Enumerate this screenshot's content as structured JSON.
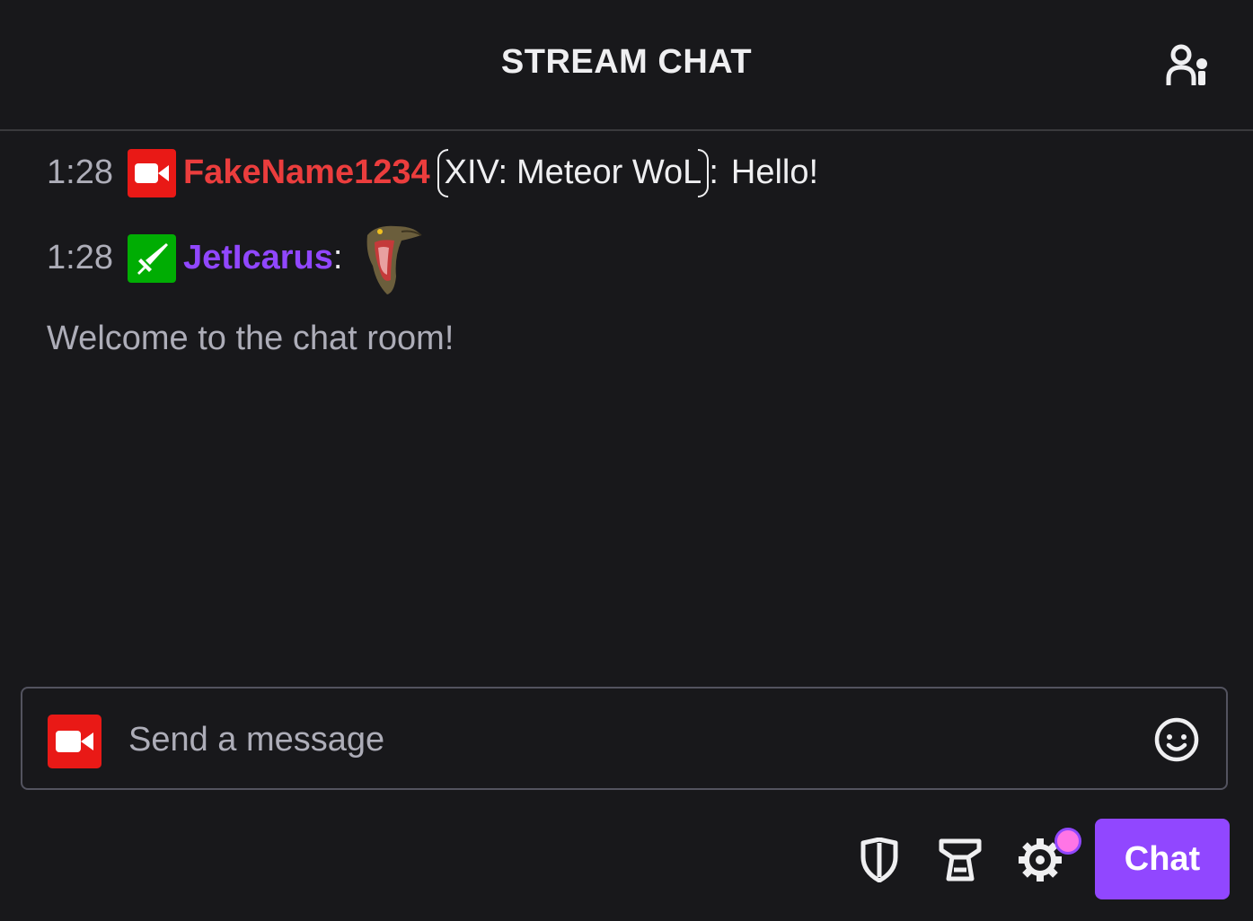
{
  "header": {
    "title": "STREAM CHAT",
    "users_icon": "users-icon"
  },
  "messages": [
    {
      "time": "1:28",
      "badge_icon": "video-camera-icon",
      "badge_color": "#e91916",
      "username": "FakeName1234",
      "username_color": "#eb3d3d",
      "title_prefix": "XIV:",
      "title_text": "Meteor WoL",
      "colon": ":",
      "text": "Hello!"
    },
    {
      "time": "1:28",
      "badge_icon": "sword-icon",
      "badge_color": "#00ad03",
      "username": "JetIcarus",
      "username_color": "#9147ff",
      "colon": ":",
      "emote_icon": "raptor-emote"
    }
  ],
  "system_message": "Welcome to the chat room!",
  "input": {
    "badge_icon": "video-camera-icon",
    "placeholder": "Send a message",
    "value": "",
    "emoji_icon": "smiley-icon"
  },
  "footer": {
    "icons": [
      "shield-icon",
      "leaderboard-icon",
      "gear-icon"
    ],
    "chat_button_label": "Chat",
    "accent_color": "#9147ff",
    "notification_color": "#ff75e6"
  }
}
